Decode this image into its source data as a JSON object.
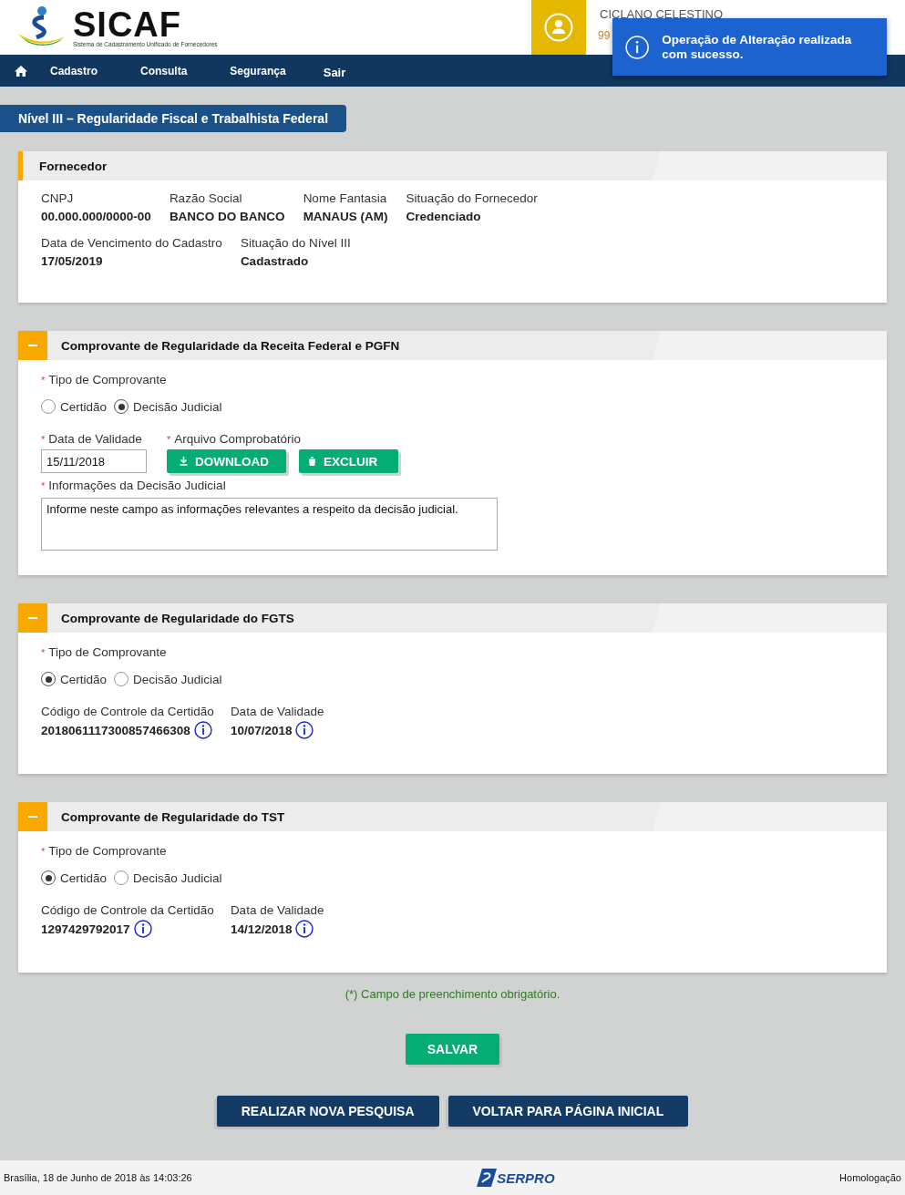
{
  "header": {
    "logo_title": "SICAF",
    "logo_subtitle": "Sistema de Cadastramento Unificado de Fornecedores",
    "user_name": "CICLANO CELESTINO",
    "user_phone": "99"
  },
  "nav": {
    "items": [
      "Cadastro",
      "Consulta",
      "Segurança",
      "Sair"
    ]
  },
  "toast": {
    "message": "Operação de Alteração realizada com sucesso."
  },
  "page_title": "Nível III – Regularidade Fiscal e Trabalhista Federal",
  "fornecedor": {
    "title": "Fornecedor",
    "rows": [
      [
        {
          "label": "CNPJ",
          "value": "00.000.000/0000-00"
        },
        {
          "label": "Razão Social",
          "value": "BANCO DO BANCO"
        },
        {
          "label": "Nome Fantasia",
          "value": "MANAUS (AM)"
        },
        {
          "label": "Situação do Fornecedor",
          "value": "Credenciado"
        }
      ],
      [
        {
          "label": "Data de Vencimento do Cadastro",
          "value": "17/05/2019"
        },
        {
          "label": "Situação do Nível III",
          "value": "Cadastrado"
        }
      ]
    ]
  },
  "sections": [
    {
      "kind": "judicial",
      "title": "Comprovante de Regularidade da Receita Federal e PGFN",
      "type_label": {
        "required_mark": "*",
        "text": "Tipo de Comprovante"
      },
      "options": [
        {
          "label": "Certidão",
          "selected": false
        },
        {
          "label": "Decisão Judicial",
          "selected": true
        }
      ],
      "date_label": {
        "required_mark": "*",
        "text": "Data de Validade"
      },
      "date_value": "15/11/2018",
      "file_label": {
        "required_mark": "*",
        "text": "Arquivo Comprobatório"
      },
      "download": "DOWNLOAD",
      "delete": "EXCLUIR",
      "info_label": {
        "required_mark": "*",
        "text": "Informações da Decisão Judicial"
      },
      "info_value": "Informe neste campo as informações relevantes a respeito da decisão judicial."
    },
    {
      "kind": "certidao",
      "title": "Comprovante de Regularidade do FGTS",
      "type_label": {
        "required_mark": "*",
        "text": "Tipo de Comprovante"
      },
      "options": [
        {
          "label": "Certidão",
          "selected": true
        },
        {
          "label": "Decisão Judicial",
          "selected": false
        }
      ],
      "fields": [
        {
          "label": "Código de Controle da Certidão",
          "value": "2018061117300857466308"
        },
        {
          "label": "Data de Validade",
          "value": "10/07/2018"
        }
      ]
    },
    {
      "kind": "certidao",
      "title": "Comprovante de Regularidade do TST",
      "type_label": {
        "required_mark": "*",
        "text": "Tipo de Comprovante"
      },
      "options": [
        {
          "label": "Certidão",
          "selected": true
        },
        {
          "label": "Decisão Judicial",
          "selected": false
        }
      ],
      "fields": [
        {
          "label": "Código de Controle da Certidão",
          "value": "1297429792017"
        },
        {
          "label": "Data de Validade",
          "value": "14/12/2018"
        }
      ]
    }
  ],
  "required_note": "(*) Campo de preenchimento obrigatório.",
  "save_button": "SALVAR",
  "actions": [
    "REALIZAR NOVA PESQUISA",
    "VOLTAR PARA PÁGINA INICIAL"
  ],
  "footer": {
    "datetime": "Brasília, 18 de Junho de 2018 às 14:03:26",
    "logo": "SERPRO",
    "environment": "Homologação"
  }
}
